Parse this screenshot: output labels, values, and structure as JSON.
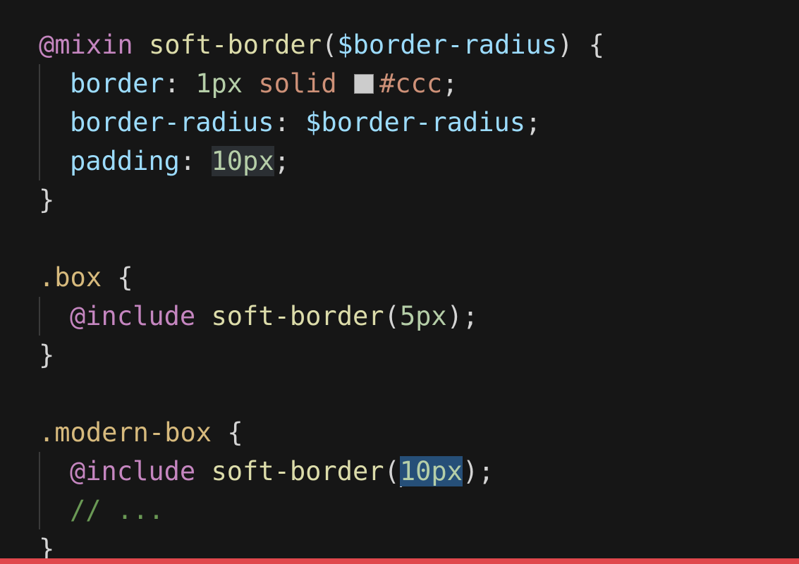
{
  "editor": {
    "language": "scss",
    "lines": [
      {
        "tokens": [
          {
            "t": "@mixin",
            "c": "at"
          },
          {
            "t": " ",
            "c": "pun"
          },
          {
            "t": "soft-border",
            "c": "fn"
          },
          {
            "t": "(",
            "c": "pun"
          },
          {
            "t": "$border-radius",
            "c": "var"
          },
          {
            "t": ") {",
            "c": "pun"
          }
        ]
      },
      {
        "indent": 1,
        "tokens": [
          {
            "t": "border",
            "c": "prop"
          },
          {
            "t": ": ",
            "c": "pun"
          },
          {
            "t": "1px",
            "c": "num"
          },
          {
            "t": " ",
            "c": "pun"
          },
          {
            "t": "solid",
            "c": "kw"
          },
          {
            "t": " ",
            "c": "pun"
          },
          {
            "swatch": "#cccccc"
          },
          {
            "t": "#ccc",
            "c": "kw"
          },
          {
            "t": ";",
            "c": "pun"
          }
        ]
      },
      {
        "indent": 1,
        "tokens": [
          {
            "t": "border-radius",
            "c": "prop"
          },
          {
            "t": ": ",
            "c": "pun"
          },
          {
            "t": "$border-radius",
            "c": "var"
          },
          {
            "t": ";",
            "c": "pun"
          }
        ]
      },
      {
        "indent": 1,
        "tokens": [
          {
            "t": "padding",
            "c": "prop"
          },
          {
            "t": ": ",
            "c": "pun"
          },
          {
            "t": "10px",
            "c": "num",
            "hl": "word"
          },
          {
            "t": ";",
            "c": "pun"
          }
        ]
      },
      {
        "tokens": [
          {
            "t": "}",
            "c": "pun"
          }
        ]
      },
      {
        "tokens": []
      },
      {
        "tokens": [
          {
            "t": ".box",
            "c": "sel"
          },
          {
            "t": " {",
            "c": "pun"
          }
        ]
      },
      {
        "indent": 1,
        "tokens": [
          {
            "t": "@include",
            "c": "at"
          },
          {
            "t": " ",
            "c": "pun"
          },
          {
            "t": "soft-border",
            "c": "fn"
          },
          {
            "t": "(",
            "c": "pun"
          },
          {
            "t": "5px",
            "c": "num"
          },
          {
            "t": ");",
            "c": "pun"
          }
        ]
      },
      {
        "tokens": [
          {
            "t": "}",
            "c": "pun"
          }
        ]
      },
      {
        "tokens": []
      },
      {
        "tokens": [
          {
            "t": ".modern-box",
            "c": "sel"
          },
          {
            "t": " {",
            "c": "pun"
          }
        ]
      },
      {
        "indent": 1,
        "tokens": [
          {
            "t": "@include",
            "c": "at"
          },
          {
            "t": " ",
            "c": "pun"
          },
          {
            "t": "soft-border",
            "c": "fn"
          },
          {
            "t": "(",
            "c": "pun"
          },
          {
            "cursor": true
          },
          {
            "t": "10px",
            "c": "num",
            "hl": "sel"
          },
          {
            "t": ");",
            "c": "pun"
          }
        ]
      },
      {
        "indent": 1,
        "tokens": [
          {
            "t": "// ...",
            "c": "cmt"
          }
        ]
      },
      {
        "tokens": [
          {
            "t": "}",
            "c": "pun"
          }
        ]
      }
    ]
  },
  "colors": {
    "background": "#161616",
    "bottom_bar": "#e0474c",
    "selection": "#264f78"
  }
}
